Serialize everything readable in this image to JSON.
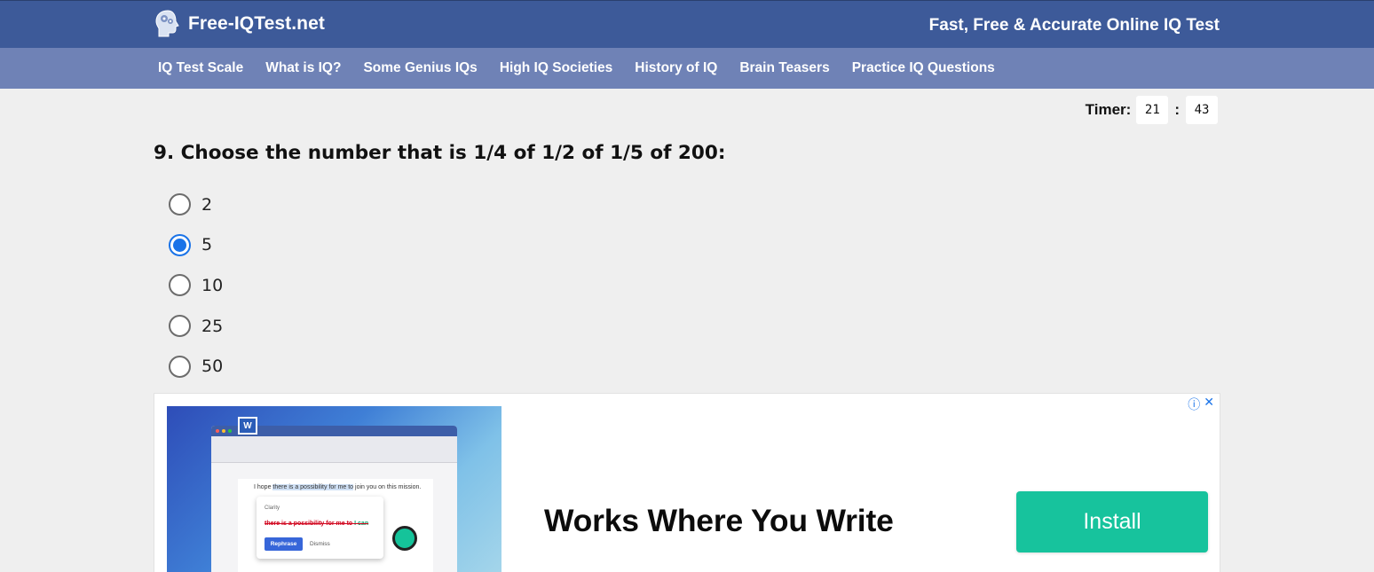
{
  "header": {
    "logo_text": "Free-IQTest.net",
    "tagline": "Fast, Free & Accurate Online IQ Test"
  },
  "nav": {
    "items": [
      {
        "label": "IQ Test Scale"
      },
      {
        "label": "What is IQ?"
      },
      {
        "label": "Some Genius IQs"
      },
      {
        "label": "High IQ Societies"
      },
      {
        "label": "History of IQ"
      },
      {
        "label": "Brain Teasers"
      },
      {
        "label": "Practice IQ Questions"
      }
    ]
  },
  "timer": {
    "label": "Timer:",
    "minutes": "21",
    "separator": ":",
    "seconds": "43"
  },
  "question": {
    "text": "9. Choose the number that is 1/4 of 1/2 of 1/5 of 200:",
    "options": [
      {
        "label": "2",
        "checked": false
      },
      {
        "label": "5",
        "checked": true
      },
      {
        "label": "10",
        "checked": false
      },
      {
        "label": "25",
        "checked": false
      },
      {
        "label": "50",
        "checked": false
      }
    ]
  },
  "ad": {
    "info_icon": "info-icon",
    "close_icon": "close-icon",
    "doc_text_before": "I hope ",
    "doc_text_highlight": "there is a possibility for me to",
    "doc_text_after": " join you on this mission.",
    "popup_title": "Clarity",
    "popup_strike": "there is a possibility for me to",
    "popup_replacement": " I can",
    "popup_rephrase": "Rephrase",
    "popup_dismiss": "Dismiss",
    "word_icon_letter": "W",
    "headline": "Works Where You Write",
    "cta": "Install",
    "cta_color": "#17c39d"
  },
  "colors": {
    "topbar": "#3d5a99",
    "navbar": "#6f82b6",
    "background": "#efefef",
    "radio_checked": "#1a73e8"
  }
}
